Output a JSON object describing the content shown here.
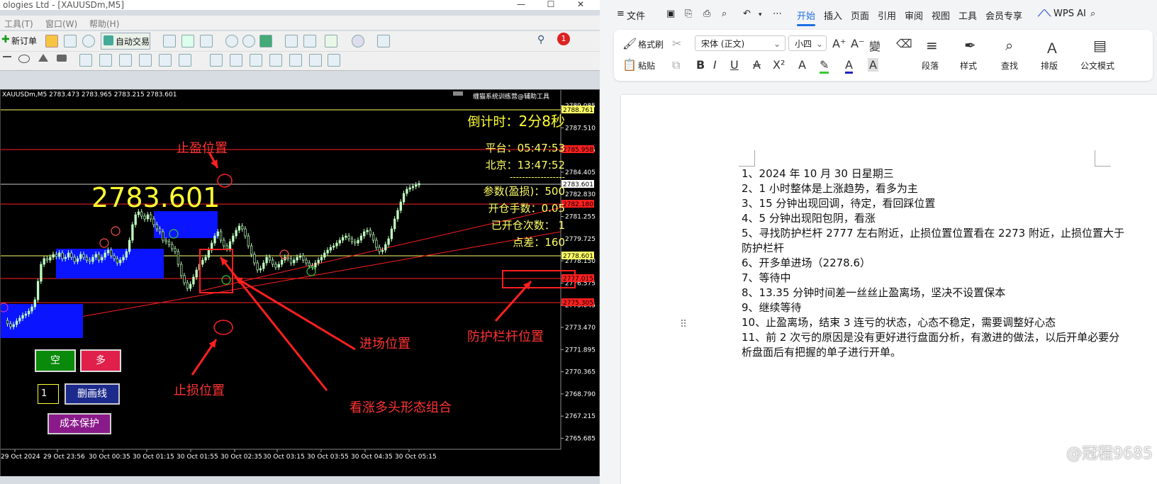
{
  "mt4": {
    "title": "ologies Ltd - [XAUUSDm,M5]",
    "menu": [
      "工具(T)",
      "窗口(W)",
      "帮助(H)"
    ],
    "toolbar": {
      "new_order": "新订单",
      "auto_trading": "自动交易",
      "notification_count": "1"
    },
    "chart": {
      "header": "XAUUSDm,M5  2783.473 2783.965 2783.215 2783.601",
      "indicator_name": "缠猫系统训练营@辅助工具",
      "big_price": "2783.601",
      "countdown_label": "倒计时：",
      "countdown_value": "2分8秒",
      "platform_time": "平台：05:47:53",
      "beijing_time": "北京：13:47:52",
      "separator": "------------------",
      "param": "参数(盈损)：500",
      "lots": "开仓手数：0.05",
      "opened": "已开仓次数：  1",
      "spread": "点差：160",
      "annotations": {
        "take_profit": "止盈位置",
        "stop_loss": "止损位置",
        "entry": "进场位置",
        "guardrail": "防护栏杆位置",
        "bullish_combo": "看涨多头形态组合"
      },
      "buttons": {
        "sell": "空",
        "buy": "多",
        "qty": "1",
        "delete_lines": "删画线",
        "breakeven": "成本保护"
      },
      "price_axis": [
        "2789.085",
        "2787.510",
        "2785.955",
        "2784.405",
        "2782.830",
        "2781.255",
        "2779.725",
        "2778.150",
        "2776.575",
        "2775.045",
        "2773.470",
        "2771.895",
        "2770.365",
        "2768.790",
        "2767.215",
        "2765.685"
      ],
      "price_tags": {
        "top_yellow": "2788.761",
        "red1": "2785.958",
        "current": "2783.601",
        "red2": "2782.180",
        "entry_yellow": "2778.601",
        "red3": "2777.015",
        "red4": "2775.305"
      },
      "time_axis": [
        "29 Oct 2024",
        "29 Oct 23:56",
        "30 Oct 00:35",
        "30 Oct 01:15",
        "30 Oct 01:55",
        "30 Oct 02:35",
        "30 Oct 03:15",
        "30 Oct 03:55",
        "30 Oct 04:35",
        "30 Oct 05:15"
      ]
    }
  },
  "wps": {
    "file_menu": "文件",
    "tabs": [
      "开始",
      "插入",
      "页面",
      "引用",
      "审阅",
      "视图",
      "工具",
      "会员专享"
    ],
    "wps_ai": "WPS AI",
    "ribbon": {
      "format_painter": "格式刷",
      "paste": "粘贴",
      "font_name": "宋体 (正文)",
      "font_size": "小四",
      "paragraph": "段落",
      "styles": "样式",
      "find": "查找",
      "layout": "排版",
      "official_mode": "公文模式"
    },
    "document_lines": [
      "1、2024 年 10 月 30 日星期三",
      "2、1 小时整体是上涨趋势，看多为主",
      "3、15 分钟出现回调，待定，看回踩位置",
      "4、5 分钟出现阳包阴，看涨",
      "5、寻找防护栏杆 2777 左右附近，止损位置位置看在 2273 附近，止损位置大于",
      "防护栏杆",
      "6、开多单进场（2278.6）",
      "7、等待中",
      "8、13.35 分钟时间差一丝丝止盈离场，坚决不设置保本",
      "9、继续等待",
      "10、止盈离场，结束 3 连亏的状态，心态不稳定，需要调整好心态",
      "11、前 2 次亏的原因是没有更好进行盘面分析，有激进的做法，以后开单必要分",
      "析盘面后有把握的单子进行开单。"
    ],
    "watermark": "@冠程9685"
  },
  "colors": {
    "chart_bg": "#000000",
    "bull_candle": "#bfffbf",
    "level_red": "#ff2020",
    "level_yellow": "#ffff66",
    "zone_blue": "#0a14ff",
    "wps_accent": "#1f6fe5"
  }
}
